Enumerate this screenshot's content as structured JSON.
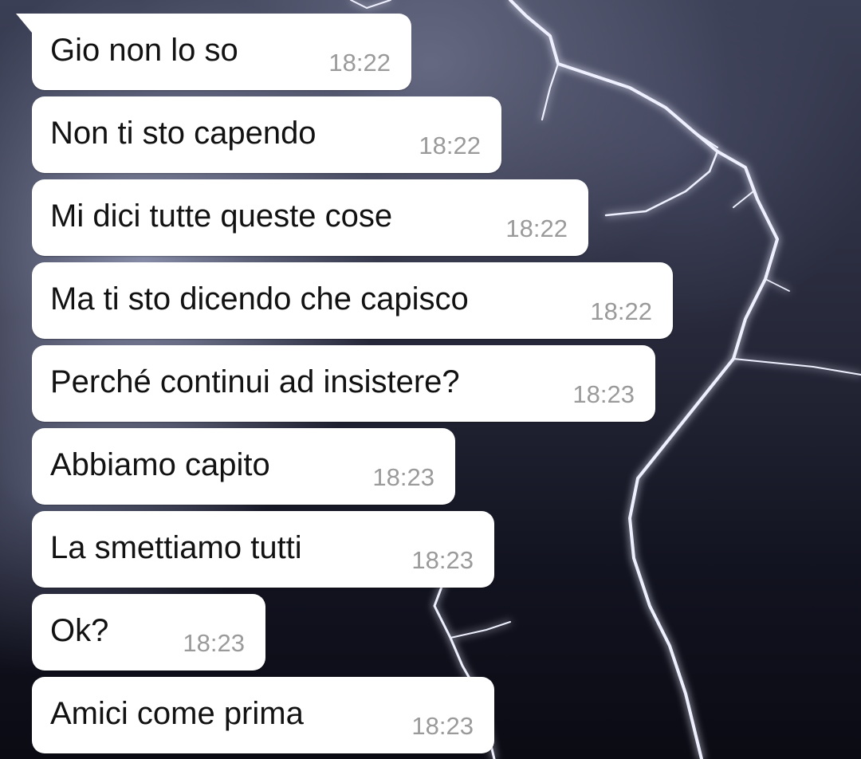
{
  "chat": {
    "messages": [
      {
        "text": "Gio non lo so",
        "time": "18:22"
      },
      {
        "text": "Non ti sto capendo",
        "time": "18:22"
      },
      {
        "text": "Mi dici tutte queste cose",
        "time": "18:22"
      },
      {
        "text": "Ma ti sto dicendo che capisco",
        "time": "18:22"
      },
      {
        "text": "Perché continui ad insistere?",
        "time": "18:23"
      },
      {
        "text": "Abbiamo capito",
        "time": "18:23"
      },
      {
        "text": "La smettiamo tutti",
        "time": "18:23"
      },
      {
        "text": "Ok?",
        "time": "18:23"
      },
      {
        "text": "Amici come prima",
        "time": "18:23"
      }
    ]
  },
  "colors": {
    "bubble": "#ffffff",
    "message_text": "#121212",
    "timestamp": "#9a9a9a"
  }
}
